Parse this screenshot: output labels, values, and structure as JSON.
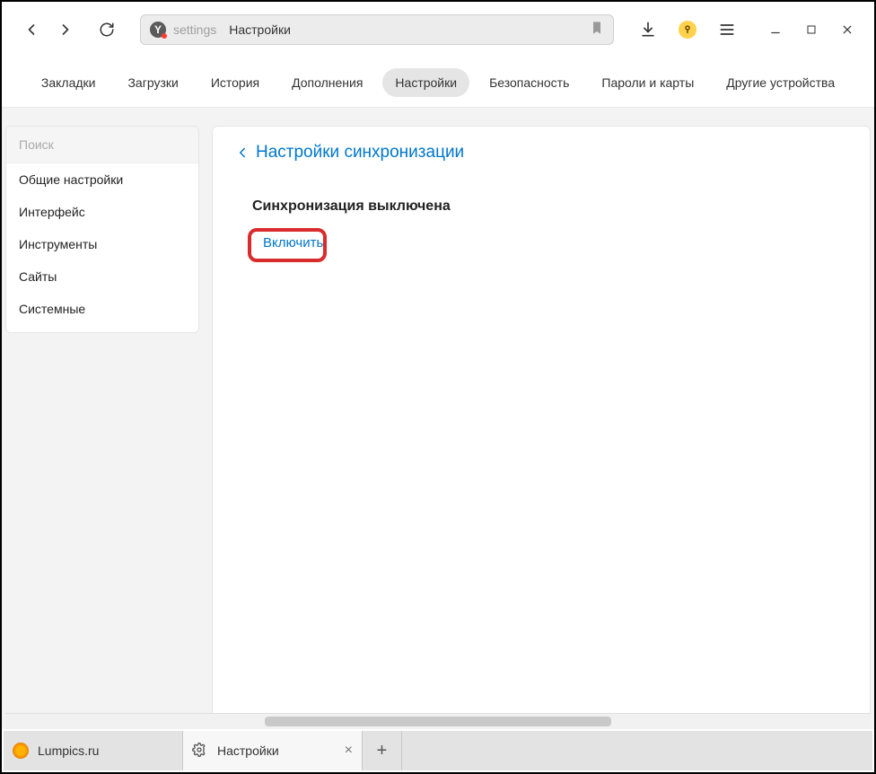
{
  "toolbar": {
    "address_prefix": "settings",
    "address_title": "Настройки"
  },
  "topnav": {
    "items": [
      {
        "label": "Закладки"
      },
      {
        "label": "Загрузки"
      },
      {
        "label": "История"
      },
      {
        "label": "Дополнения"
      },
      {
        "label": "Настройки",
        "active": true
      },
      {
        "label": "Безопасность"
      },
      {
        "label": "Пароли и карты"
      },
      {
        "label": "Другие устройства"
      }
    ]
  },
  "sidebar": {
    "search_placeholder": "Поиск",
    "items": [
      {
        "label": "Общие настройки"
      },
      {
        "label": "Интерфейс"
      },
      {
        "label": "Инструменты"
      },
      {
        "label": "Сайты"
      },
      {
        "label": "Системные"
      }
    ]
  },
  "main": {
    "back_title": "Настройки синхронизации",
    "sync_status": "Синхронизация выключена",
    "enable_label": "Включить"
  },
  "tabs": {
    "items": [
      {
        "label": "Lumpics.ru",
        "icon": "lumpics"
      },
      {
        "label": "Настройки",
        "icon": "gear",
        "active": true
      }
    ],
    "newtab": "+"
  }
}
